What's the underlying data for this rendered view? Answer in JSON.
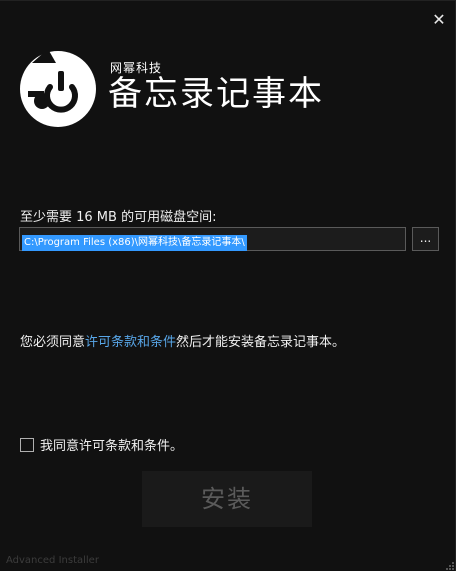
{
  "window": {
    "close_glyph": "✕"
  },
  "brand": {
    "icon": "puzzle-power-logo-icon",
    "subtitle": "网幂科技",
    "title": "备忘录记事本"
  },
  "install_location": {
    "space_label": "至少需要 16 MB 的可用磁盘空间:",
    "path_value": "C:\\Program Files (x86)\\网幂科技\\备忘录记事本\\",
    "browse_label": "..."
  },
  "license": {
    "prefix": "您必须同意",
    "link_text": "许可条款和条件",
    "suffix": "然后才能安装备忘录记事本。"
  },
  "agree": {
    "label": "我同意许可条款和条件。",
    "checked": false
  },
  "actions": {
    "install_label": "安装"
  },
  "footer": {
    "brand": "Advanced Installer"
  },
  "colors": {
    "background": "#111111",
    "link": "#58a6e8",
    "selection": "#3399ff",
    "disabled_text": "#5a5a5a"
  }
}
